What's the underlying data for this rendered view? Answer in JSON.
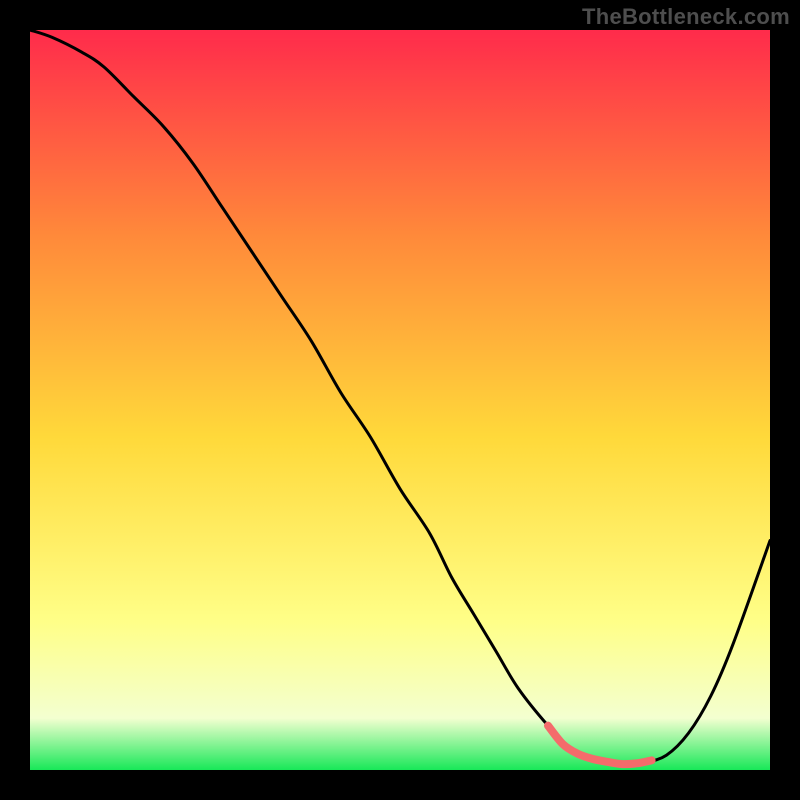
{
  "watermark": "TheBottleneck.com",
  "colors": {
    "gradient_top": "#ff2b4b",
    "gradient_mid_upper": "#ff8a3a",
    "gradient_mid": "#ffd93a",
    "gradient_lower": "#ffff88",
    "gradient_near_bottom": "#f3ffd0",
    "gradient_bottom": "#18e858",
    "frame": "#000000",
    "curve": "#000000",
    "highlight": "#f46b6b"
  },
  "chart_data": {
    "type": "line",
    "title": "",
    "xlabel": "",
    "ylabel": "",
    "xlim": [
      0,
      100
    ],
    "ylim": [
      0,
      100
    ],
    "series": [
      {
        "name": "bottleneck-curve",
        "x": [
          0,
          3,
          7,
          10,
          14,
          18,
          22,
          26,
          30,
          34,
          38,
          42,
          46,
          50,
          54,
          57,
          60,
          63,
          66,
          70,
          73,
          76,
          80,
          83,
          86,
          89,
          92,
          95,
          100
        ],
        "y": [
          100,
          99,
          97,
          95,
          91,
          87,
          82,
          76,
          70,
          64,
          58,
          51,
          45,
          38,
          32,
          26,
          21,
          16,
          11,
          6,
          3,
          1.5,
          0.8,
          1.0,
          2.0,
          5.0,
          10,
          17,
          31
        ]
      },
      {
        "name": "optimal-range-highlight",
        "x": [
          70,
          72,
          74,
          76,
          78,
          80,
          82,
          84
        ],
        "y": [
          6,
          3.5,
          2.2,
          1.5,
          1.1,
          0.8,
          0.9,
          1.3
        ]
      }
    ],
    "annotations": []
  }
}
